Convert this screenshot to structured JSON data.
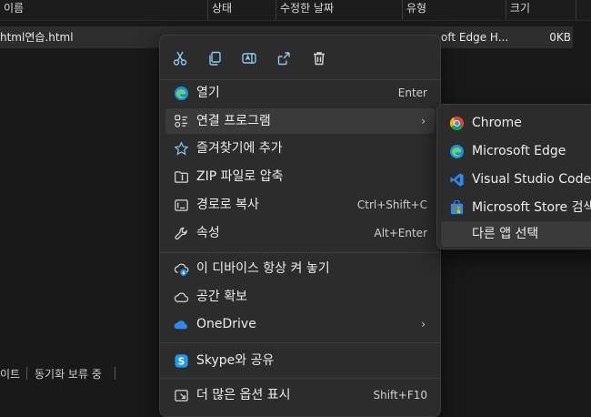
{
  "columns": [
    {
      "label": "이름"
    },
    {
      "label": "상태"
    },
    {
      "label": "수정한 날짜"
    },
    {
      "label": "유형"
    },
    {
      "label": "크기"
    }
  ],
  "file": {
    "name": "html연습.html",
    "type": "oft Edge H...",
    "size": "0KB"
  },
  "status_bar": {
    "left": "이트",
    "sync": "동기화 보류 중"
  },
  "quick_actions": [
    {
      "name": "cut",
      "icon": "scissors-icon"
    },
    {
      "name": "copy",
      "icon": "copy-icon"
    },
    {
      "name": "rename",
      "icon": "rename-icon"
    },
    {
      "name": "share",
      "icon": "share-icon"
    },
    {
      "name": "delete",
      "icon": "trash-icon"
    }
  ],
  "menu": {
    "open": {
      "label": "열기",
      "shortcut": "Enter"
    },
    "open_with": {
      "label": "연결 프로그램"
    },
    "favorites": {
      "label": "즐겨찾기에 추가"
    },
    "zip": {
      "label": "ZIP 파일로 압축"
    },
    "copy_path": {
      "label": "경로로 복사",
      "shortcut": "Ctrl+Shift+C"
    },
    "properties": {
      "label": "속성",
      "shortcut": "Alt+Enter"
    },
    "keep_on_device": {
      "label": "이 디바이스 항상 켜 놓기"
    },
    "free_space": {
      "label": "공간 확보"
    },
    "onedrive": {
      "label": "OneDrive"
    },
    "skype": {
      "label": "Skype와 공유"
    },
    "more_options": {
      "label": "더 많은 옵션 표시",
      "shortcut": "Shift+F10"
    }
  },
  "submenu": {
    "chrome": "Chrome",
    "edge": "Microsoft Edge",
    "vscode": "Visual Studio Code",
    "store": "Microsoft Store 검색",
    "choose": "다른 앱 선택"
  },
  "colors": {
    "background": "#191919",
    "menu_bg": "#2c2c2c",
    "highlight": "#3a3a3a",
    "accent_blue": "#4cc2ff",
    "vscode_blue": "#2a8bf2",
    "skype_blue": "#1d9bf0"
  }
}
